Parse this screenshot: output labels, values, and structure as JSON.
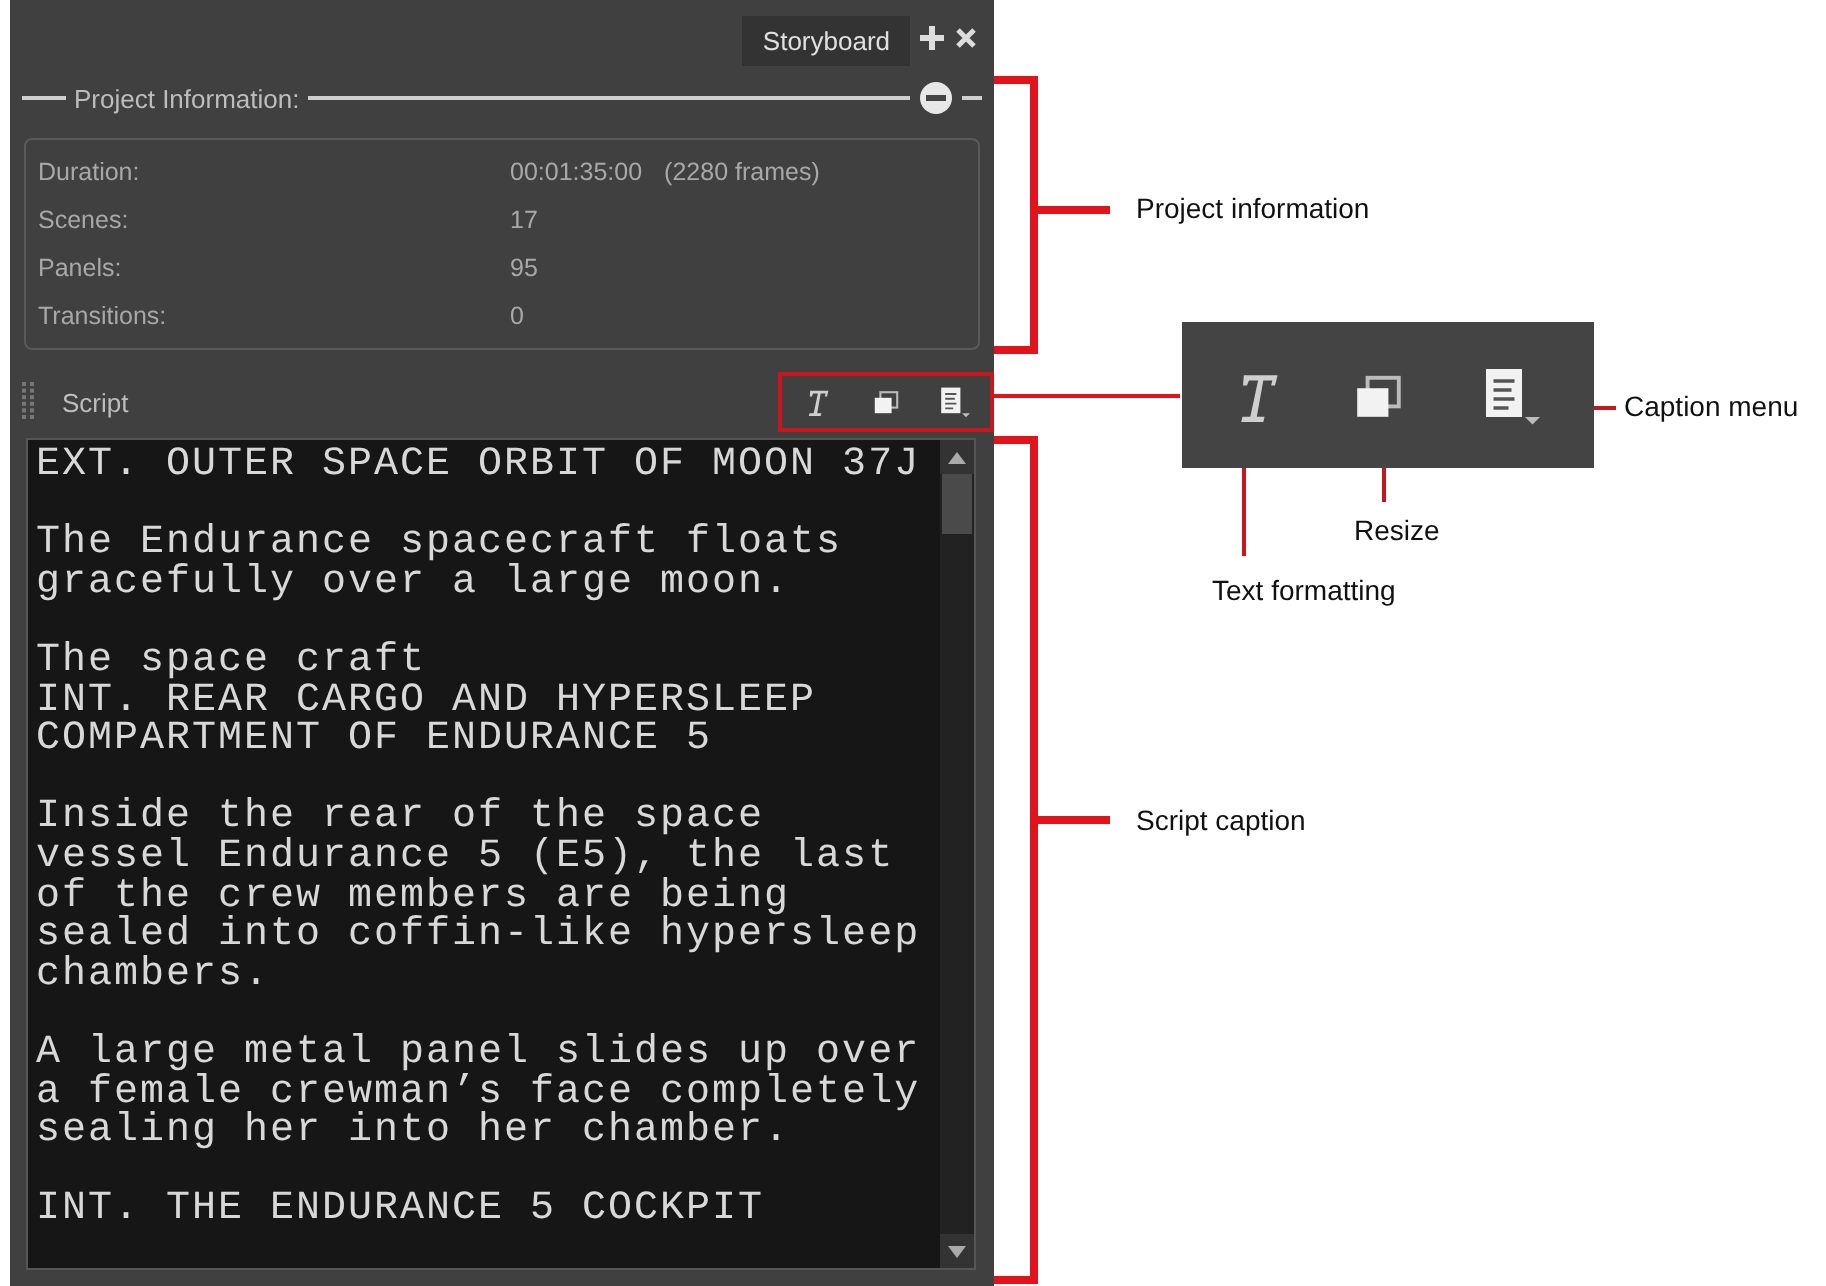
{
  "panel": {
    "tab": "Storyboard",
    "section_title": "Project Information:",
    "info_rows": [
      {
        "label": "Duration:",
        "value": "00:01:35:00",
        "extra": "(2280 frames)"
      },
      {
        "label": "Scenes:",
        "value": "17"
      },
      {
        "label": "Panels:",
        "value": "95"
      },
      {
        "label": "Transitions:",
        "value": "0"
      }
    ],
    "script_title": "Script",
    "script_paragraphs": [
      [
        "EXT. OUTER SPACE ORBIT OF MOON 37J"
      ],
      [
        "The Endurance spacecraft floats",
        "gracefully over a large moon."
      ],
      [
        "The space craft",
        "INT. REAR CARGO AND HYPERSLEEP",
        "COMPARTMENT OF ENDURANCE 5"
      ],
      [
        "Inside the rear of the space",
        "vessel Endurance 5 (E5), the last",
        "of the crew members are being",
        "sealed into coffin-like hypersleep",
        "chambers."
      ],
      [
        "A large metal panel slides up over",
        "a female crewman’s face completely",
        "sealing her into her chamber."
      ],
      [
        "INT. THE ENDURANCE 5 COCKPIT"
      ]
    ]
  },
  "callouts": {
    "project_information": "Project information",
    "script_caption": "Script caption",
    "caption_menu": "Caption menu",
    "resize": "Resize",
    "text_formatting": "Text formatting"
  }
}
